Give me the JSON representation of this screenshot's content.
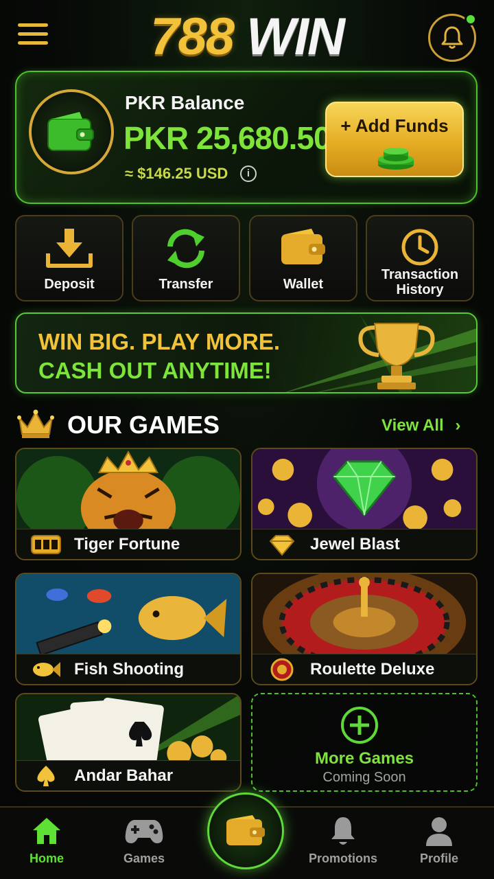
{
  "header": {
    "logo_number": "788",
    "logo_word": "WIN",
    "menu_icon": "hamburger-menu-icon",
    "notification_icon": "bell-icon",
    "notification_dot_color": "#55e03a"
  },
  "balance": {
    "label": "PKR Balance",
    "amount": "PKR 25,680.50",
    "usd": "≈ $146.25 USD",
    "info_glyph": "i",
    "add_funds_label": "+ Add Funds"
  },
  "actions": [
    {
      "label": "Deposit",
      "icon": "download-tray-icon"
    },
    {
      "label": "Transfer",
      "icon": "refresh-arrows-icon"
    },
    {
      "label": "Wallet",
      "icon": "wallet-icon"
    },
    {
      "label": "Transaction",
      "label2": "History",
      "icon": "clock-icon"
    }
  ],
  "promo": {
    "line1": "WIN BIG. PLAY MORE.",
    "line2": "CASH OUT ANYTIME!"
  },
  "games_section": {
    "title": "OUR GAMES",
    "view_all": "View All"
  },
  "games": [
    {
      "name": "Tiger Fortune",
      "icon": "slot-machine-icon"
    },
    {
      "name": "Jewel Blast",
      "icon": "diamond-icon"
    },
    {
      "name": "Fish Shooting",
      "icon": "fish-icon"
    },
    {
      "name": "Roulette Deluxe",
      "icon": "roulette-wheel-icon"
    },
    {
      "name": "Andar Bahar",
      "icon": "spade-icon"
    }
  ],
  "more_games": {
    "title": "More Games",
    "subtitle": "Coming Soon"
  },
  "nav": [
    {
      "label": "Home",
      "active": true
    },
    {
      "label": "Games",
      "active": false
    },
    {
      "label": "Promotions",
      "active": false
    },
    {
      "label": "Profile",
      "active": false
    }
  ],
  "colors": {
    "accent_green": "#7ee33a",
    "accent_gold": "#f2c23a",
    "background": "#070907"
  }
}
